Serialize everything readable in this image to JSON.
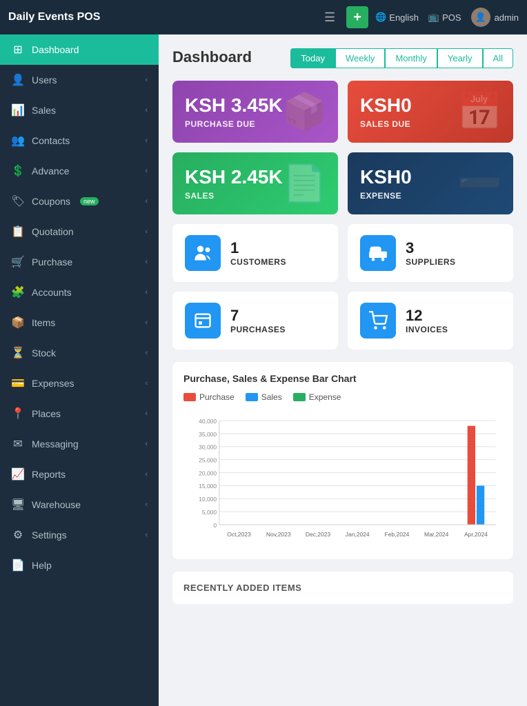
{
  "topnav": {
    "title": "Daily Events POS",
    "language": "English",
    "pos_label": "POS",
    "admin_label": "admin"
  },
  "sidebar": {
    "items": [
      {
        "id": "dashboard",
        "label": "Dashboard",
        "icon": "🏠",
        "active": true,
        "chevron": false
      },
      {
        "id": "users",
        "label": "Users",
        "icon": "👤",
        "active": false,
        "chevron": true
      },
      {
        "id": "sales",
        "label": "Sales",
        "icon": "📊",
        "active": false,
        "chevron": true
      },
      {
        "id": "contacts",
        "label": "Contacts",
        "icon": "👥",
        "active": false,
        "chevron": true
      },
      {
        "id": "advance",
        "label": "Advance",
        "icon": "💲",
        "active": false,
        "chevron": true
      },
      {
        "id": "coupons",
        "label": "Coupons",
        "icon": "🏷",
        "active": false,
        "chevron": true,
        "badge": "new"
      },
      {
        "id": "quotation",
        "label": "Quotation",
        "icon": "📋",
        "active": false,
        "chevron": true
      },
      {
        "id": "purchase",
        "label": "Purchase",
        "icon": "🛒",
        "active": false,
        "chevron": true
      },
      {
        "id": "accounts",
        "label": "Accounts",
        "icon": "🧩",
        "active": false,
        "chevron": true
      },
      {
        "id": "items",
        "label": "Items",
        "icon": "📦",
        "active": false,
        "chevron": true
      },
      {
        "id": "stock",
        "label": "Stock",
        "icon": "⏳",
        "active": false,
        "chevron": true
      },
      {
        "id": "expenses",
        "label": "Expenses",
        "icon": "⚙",
        "active": false,
        "chevron": true
      },
      {
        "id": "places",
        "label": "Places",
        "icon": "📍",
        "active": false,
        "chevron": true
      },
      {
        "id": "messaging",
        "label": "Messaging",
        "icon": "✉",
        "active": false,
        "chevron": true
      },
      {
        "id": "reports",
        "label": "Reports",
        "icon": "📈",
        "active": false,
        "chevron": true
      },
      {
        "id": "warehouse",
        "label": "Warehouse",
        "icon": "🖥",
        "active": false,
        "chevron": true
      },
      {
        "id": "settings",
        "label": "Settings",
        "icon": "⚙",
        "active": false,
        "chevron": true
      },
      {
        "id": "help",
        "label": "Help",
        "icon": "📄",
        "active": false,
        "chevron": false
      }
    ]
  },
  "dashboard": {
    "title": "Dashboard",
    "filter_tabs": [
      {
        "id": "today",
        "label": "Today",
        "active": true
      },
      {
        "id": "weekly",
        "label": "Weekly",
        "active": false
      },
      {
        "id": "monthly",
        "label": "Monthly",
        "active": false
      },
      {
        "id": "yearly",
        "label": "Yearly",
        "active": false
      },
      {
        "id": "all",
        "label": "All",
        "active": false
      }
    ],
    "stat_cards": [
      {
        "id": "purchase-due",
        "amount": "KSH 3.45K",
        "label": "PURCHASE DUE",
        "style": "card-purple",
        "icon": "📦"
      },
      {
        "id": "sales-due",
        "amount": "KSH0",
        "label": "SALES DUE",
        "style": "card-red",
        "icon": "📅"
      },
      {
        "id": "sales",
        "amount": "KSH 2.45K",
        "label": "SALES",
        "style": "card-green",
        "icon": "📄"
      },
      {
        "id": "expense",
        "amount": "KSH0",
        "label": "EXPENSE",
        "style": "card-navy",
        "icon": "➖"
      }
    ],
    "count_cards": [
      {
        "id": "customers",
        "count": "1",
        "label": "CUSTOMERS",
        "icon": "👥"
      },
      {
        "id": "suppliers",
        "count": "3",
        "label": "SUPPLIERS",
        "icon": "🚚"
      },
      {
        "id": "purchases",
        "count": "7",
        "label": "PURCHASES",
        "icon": "💼"
      },
      {
        "id": "invoices",
        "count": "12",
        "label": "INVOICES",
        "icon": "🛒"
      }
    ],
    "chart": {
      "title": "Purchase, Sales & Expense Bar Chart",
      "legend": [
        {
          "id": "purchase",
          "label": "Purchase",
          "color": "#e74c3c"
        },
        {
          "id": "sales",
          "label": "Sales",
          "color": "#2196f3"
        },
        {
          "id": "expense",
          "label": "Expense",
          "color": "#27ae60"
        }
      ],
      "y_labels": [
        "40,000",
        "35,000",
        "30,000",
        "25,000",
        "20,000",
        "15,000",
        "10,000",
        "5,000",
        "0"
      ],
      "x_labels": [
        "Oct,2023",
        "Nov,2023",
        "Dec,2023",
        "Jan,2024",
        "Feb,2024",
        "Mar,2024",
        "Apr,2024"
      ],
      "bars": [
        {
          "month": "Oct,2023",
          "purchase": 0,
          "sales": 0,
          "expense": 0
        },
        {
          "month": "Nov,2023",
          "purchase": 0,
          "sales": 0,
          "expense": 0
        },
        {
          "month": "Dec,2023",
          "purchase": 0,
          "sales": 0,
          "expense": 0
        },
        {
          "month": "Jan,2024",
          "purchase": 0,
          "sales": 0,
          "expense": 0
        },
        {
          "month": "Feb,2024",
          "purchase": 0,
          "sales": 0,
          "expense": 0
        },
        {
          "month": "Mar,2024",
          "purchase": 0,
          "sales": 0,
          "expense": 0
        },
        {
          "month": "Apr,2024",
          "purchase": 38000,
          "sales": 15000,
          "expense": 0
        }
      ],
      "max_value": 40000
    },
    "recently_added": {
      "title": "RECENTLY ADDED ITEMS"
    }
  }
}
